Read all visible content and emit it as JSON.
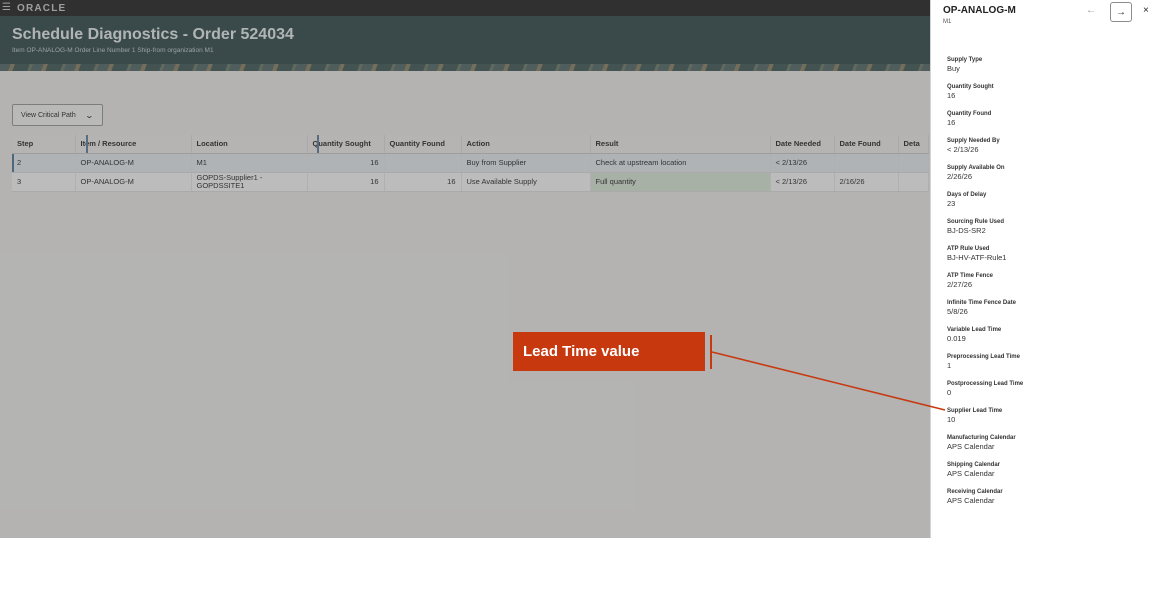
{
  "topbar": {
    "menu_icon": "☰",
    "logo": "ORACLE"
  },
  "header": {
    "title": "Schedule Diagnostics - Order 524034",
    "subtitle": "Item OP-ANALOG-M Order Line Number 1 Ship-from organization M1"
  },
  "toolbar": {
    "view_button": "View Critical Path",
    "chevron": "⌄"
  },
  "table": {
    "columns": [
      "Step",
      "Item / Resource",
      "Location",
      "Quantity Sought",
      "Quantity Found",
      "Action",
      "Result",
      "Date Needed",
      "Date Found",
      "Deta"
    ],
    "rows": [
      {
        "step": "2",
        "item": "OP-ANALOG-M",
        "location": "M1",
        "sought": "16",
        "found": "",
        "action": "Buy from Supplier",
        "result": "Check at upstream location",
        "needed": "< 2/13/26",
        "date_found": "",
        "detail": ""
      },
      {
        "step": "3",
        "item": "OP-ANALOG-M",
        "location": "GOPDS-Supplier1 - GOPDSSITE1",
        "sought": "16",
        "found": "16",
        "action": "Use Available Supply",
        "result": "Full quantity",
        "needed": "< 2/13/26",
        "date_found": "2/16/26",
        "detail": ""
      }
    ]
  },
  "drawer": {
    "title": "OP-ANALOG-M",
    "subtitle": "M1",
    "back_icon": "←",
    "forward_icon": "→",
    "close_icon": "×",
    "fields": [
      {
        "label": "Supply Type",
        "value": "Buy"
      },
      {
        "label": "Quantity Sought",
        "value": "16"
      },
      {
        "label": "Quantity Found",
        "value": "16"
      },
      {
        "label": "Supply Needed By",
        "value": "< 2/13/26"
      },
      {
        "label": "Supply Available On",
        "value": "2/26/26"
      },
      {
        "label": "Days of Delay",
        "value": "23"
      },
      {
        "label": "Sourcing Rule Used",
        "value": "BJ-DS-SR2"
      },
      {
        "label": "ATP Rule Used",
        "value": "BJ-HV-ATF-Rule1"
      },
      {
        "label": "ATP Time Fence",
        "value": "2/27/26"
      },
      {
        "label": "Infinite Time Fence Date",
        "value": "5/8/26"
      },
      {
        "label": "Variable Lead Time",
        "value": "0.019"
      },
      {
        "label": "Preprocessing Lead Time",
        "value": "1"
      },
      {
        "label": "Postprocessing Lead Time",
        "value": "0"
      },
      {
        "label": "Supplier Lead Time",
        "value": "10"
      },
      {
        "label": "Manufacturing Calendar",
        "value": "APS Calendar"
      },
      {
        "label": "Shipping Calendar",
        "value": "APS Calendar"
      },
      {
        "label": "Receiving Calendar",
        "value": "APS Calendar"
      }
    ]
  },
  "callout": {
    "text": "Lead Time value"
  },
  "colors": {
    "header": "#2e4748",
    "callout": "#c7380f",
    "overlay": "rgba(80,80,80,0.38)"
  }
}
